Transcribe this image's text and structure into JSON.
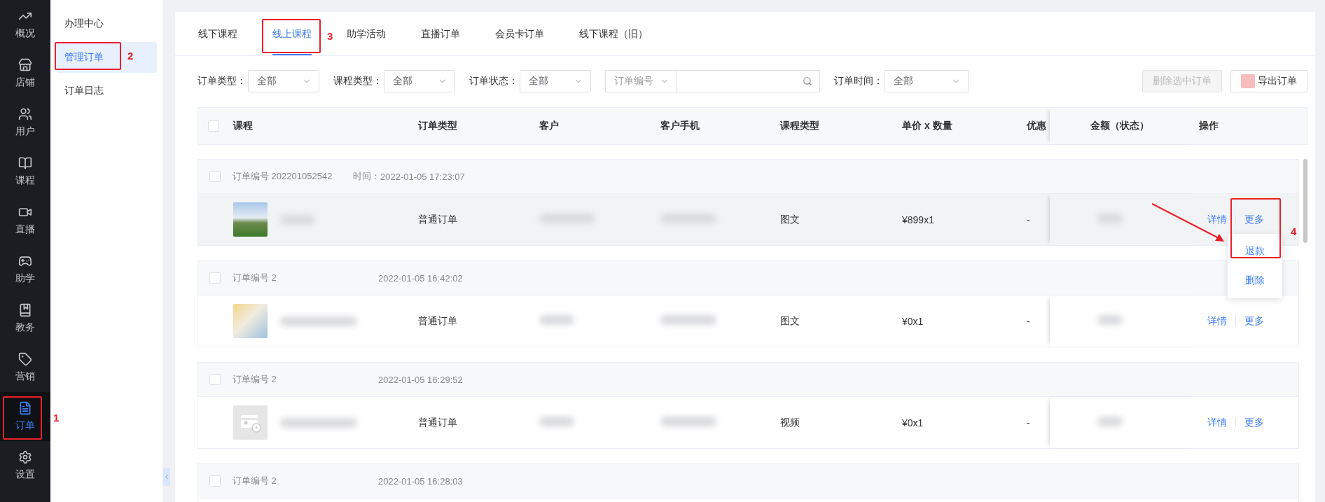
{
  "nav": [
    {
      "label": "概况",
      "selected": false
    },
    {
      "label": "店铺",
      "selected": false
    },
    {
      "label": "用户",
      "selected": false
    },
    {
      "label": "课程",
      "selected": false
    },
    {
      "label": "直播",
      "selected": false
    },
    {
      "label": "助学",
      "selected": false
    },
    {
      "label": "教务",
      "selected": false
    },
    {
      "label": "营销",
      "selected": false
    },
    {
      "label": "订单",
      "selected": true,
      "annotation": "1"
    },
    {
      "label": "设置",
      "selected": false
    }
  ],
  "submenu": {
    "items": [
      {
        "label": "办理中心",
        "selected": false
      },
      {
        "label": "管理订单",
        "selected": true,
        "annotation": "2"
      },
      {
        "label": "订单日志",
        "selected": false
      }
    ]
  },
  "tabs": [
    {
      "label": "线下课程",
      "selected": false
    },
    {
      "label": "线上课程",
      "selected": true,
      "annotation": "3"
    },
    {
      "label": "助学活动",
      "selected": false
    },
    {
      "label": "直播订单",
      "selected": false
    },
    {
      "label": "会员卡订单",
      "selected": false
    },
    {
      "label": "线下课程（旧）",
      "selected": false
    }
  ],
  "filters": [
    {
      "label": "订单类型：",
      "value": "全部"
    },
    {
      "label": "课程类型：",
      "value": "全部"
    },
    {
      "label": "订单状态：",
      "value": "全部"
    }
  ],
  "search": {
    "field": "订单编号"
  },
  "time_filter": {
    "label": "订单时间：",
    "value": "全部"
  },
  "buttons": [
    {
      "label": "删除选中订单",
      "disabled": true
    },
    {
      "label": "导出订单",
      "disabled": false
    }
  ],
  "table": {
    "header_checked": false,
    "columns": [
      "课程",
      "订单类型",
      "客户",
      "客户手机",
      "课程类型",
      "单价 x 数量",
      "优惠",
      "金额（状态）",
      "操作"
    ],
    "groups": [
      {
        "order_no": "订单编号 202201052542",
        "time_label": "时间：",
        "time": "2022-01-05 17:23:07",
        "checked": false,
        "hovered": true,
        "kind": "photo",
        "order_type": "普通订单",
        "course_type": "图文",
        "price": "¥899x1",
        "discount": "-",
        "actions": [
          "详情",
          "更多"
        ],
        "menu": {
          "annotation": "4",
          "items": [
            "退款",
            "删除"
          ]
        }
      },
      {
        "order_no": "订单编号 2",
        "time": "2022-01-05 16:42:02",
        "checked": false,
        "hovered": false,
        "kind": "photo",
        "order_type": "普通订单",
        "course_type": "图文",
        "price": "¥0x1",
        "discount": "-",
        "actions": [
          "详情",
          "更多"
        ]
      },
      {
        "order_no": "订单编号 2",
        "time": "2022-01-05 16:29:52",
        "checked": false,
        "hovered": false,
        "kind": "placeholder",
        "order_type": "普通订单",
        "course_type": "视频",
        "price": "¥0x1",
        "discount": "-",
        "actions": [
          "详情",
          "更多"
        ]
      },
      {
        "order_no": "订单编号 2",
        "time": "2022-01-05 16:28:03",
        "checked": false,
        "hovered": false
      }
    ]
  }
}
